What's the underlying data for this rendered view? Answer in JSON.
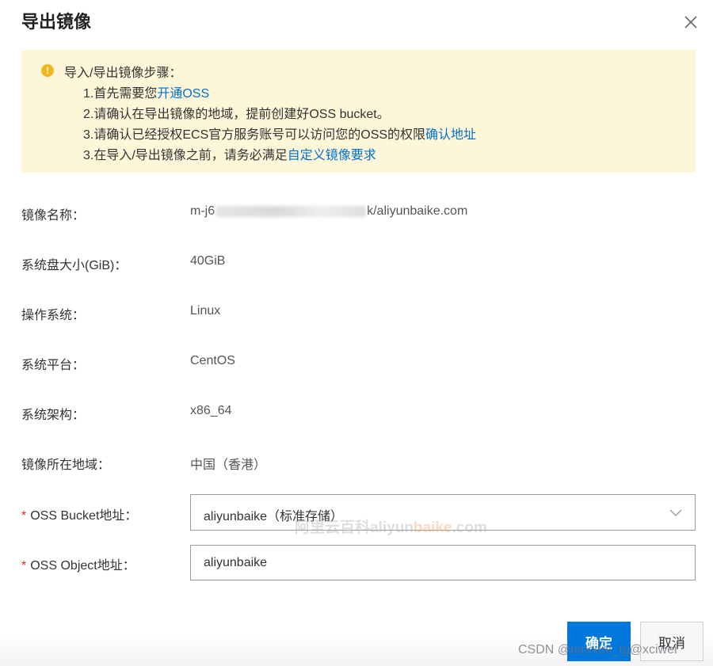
{
  "dialog": {
    "title": "导出镜像",
    "close_icon": "close-icon"
  },
  "notice": {
    "icon": "warning-icon",
    "title": "导入/导出镜像步骤：",
    "line1_text": "1.首先需要您",
    "line1_link": "开通OSS",
    "line2_text": "2.请确认在导出镜像的地域，提前创建好OSS bucket。",
    "line3_text": "3.请确认已经授权ECS官方服务账号可以访问您的OSS的权限",
    "line3_link": "确认地址",
    "line4_text": "3.在导入/导出镜像之前，请务必满足",
    "line4_link": "自定义镜像要求",
    "colors": {
      "background": "#fdf6d8",
      "icon": "#f5b61c",
      "link": "#0070cc"
    }
  },
  "details": {
    "image_name_label": "镜像名称：",
    "image_name_prefix": "m-j6",
    "image_name_suffix": "k/aliyunbaike.com",
    "disk_size_label": "系统盘大小(GiB)：",
    "disk_size_value": "40GiB",
    "os_label": "操作系统：",
    "os_value": "Linux",
    "platform_label": "系统平台：",
    "platform_value": "CentOS",
    "arch_label": "系统架构：",
    "arch_value": "x86_64",
    "region_label": "镜像所在地域：",
    "region_value": "中国（香港）"
  },
  "form": {
    "required_mark": "*",
    "bucket_label": "OSS Bucket地址：",
    "bucket_value": "aliyunbaike（标准存储）",
    "object_label": "OSS Object地址：",
    "object_value": "aliyunbaike"
  },
  "watermark": {
    "cn": "阿里云百科",
    "en_a": "aliyun",
    "en_b": "baike",
    "en_c": ".com"
  },
  "footer": {
    "confirm_label": "确定",
    "cancel_label": "取消",
    "confirm_color": "#0077dd",
    "csdn_watermark": "CSDN @tencent_tg@xciwei"
  }
}
